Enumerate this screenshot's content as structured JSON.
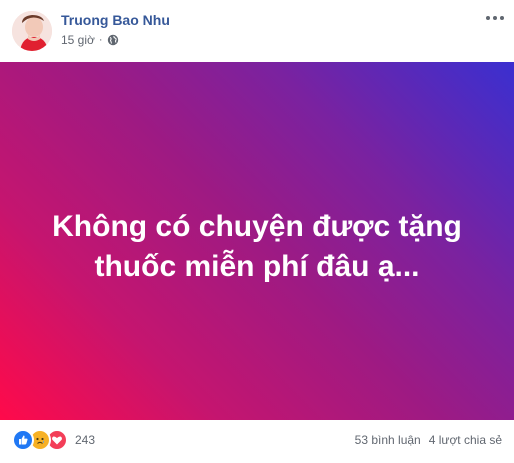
{
  "post": {
    "author": "Truong Bao Nhu",
    "time": "15 giờ",
    "separator": "·",
    "privacy_icon": "globe-icon",
    "more_icon": "more-options-icon",
    "content_text_line1": "Không có chuyện được tặng",
    "content_text_line2": "thuốc miễn phí đâu ạ...",
    "background_colors": [
      "#ff0a4a",
      "#9e1a83",
      "#3a2fd0"
    ]
  },
  "footer": {
    "reaction_icons": [
      "like-icon",
      "sad-icon",
      "love-icon"
    ],
    "reaction_count": "243",
    "comments": "53 bình luận",
    "shares": "4 lượt chia sẻ"
  },
  "colors": {
    "author_link": "#365899",
    "meta_text": "#616770",
    "like_blue": "#2078f4",
    "sad_yellow": "#f7b125",
    "love_red": "#f33e58"
  }
}
